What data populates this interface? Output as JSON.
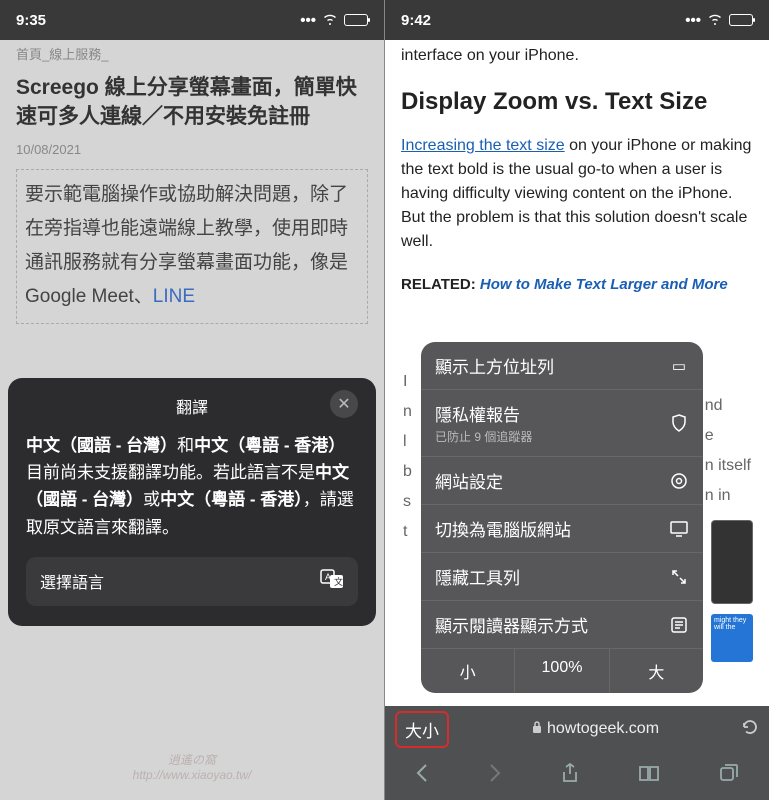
{
  "left": {
    "status_time": "9:35",
    "breadcrumb": "首頁_線上服務_",
    "title": "Screego 線上分享螢幕畫面，簡單快速可多人連線／不用安裝免註冊",
    "date": "10/08/2021",
    "body_text": "要示範電腦操作或協助解決問題，除了在旁指導也能遠端線上教學，使用即時通訊服務就有分享螢幕畫面功能，像是 Google Meet、",
    "body_link": "LINE",
    "sheet": {
      "title": "翻譯",
      "body_parts": {
        "b1": "中文（國語 - 台灣）",
        "t1": "和",
        "b2": "中文（粵語 - 香港）",
        "t2": "目前尚未支援翻譯功能。若此語言不是",
        "b3": "中文（國語 - 台灣）",
        "t3": "或",
        "b4": "中文（粵語 - 香港）",
        "t4": "，請選取原文語言來翻譯。"
      },
      "select_lang": "選擇語言"
    },
    "watermark_1": "逍遙の窩",
    "watermark_2": "http://www.xiaoyao.tw/"
  },
  "right": {
    "status_time": "9:42",
    "p1_trail": "interface on your iPhone.",
    "h2": "Display Zoom vs. Text Size",
    "p2_link": "Increasing the text size",
    "p2_rest": " on your iPhone or making the text bold is the usual go-to when a user is having difficulty viewing content on the iPhone. But the problem is that this solution doesn't scale well.",
    "related_label": "RELATED:",
    "related_link": "How to Make Text Larger and More",
    "trail": [
      "I",
      "n",
      "l",
      "b",
      "s",
      "t"
    ],
    "trail_words": {
      "a": "nd",
      "b": "e",
      "c": "n itself",
      "d": "n in"
    },
    "popup": {
      "item1": "顯示上方位址列",
      "item2": "隱私權報告",
      "item2_sub": "已防止 9 個追蹤器",
      "item3": "網站設定",
      "item4": "切換為電腦版網站",
      "item5": "隱藏工具列",
      "item6": "顯示閱讀器顯示方式",
      "zoom_small": "小",
      "zoom_val": "100%",
      "zoom_large": "大"
    },
    "aa_label": "大小",
    "url": "howtogeek.com",
    "preview_text": "might they will the"
  }
}
